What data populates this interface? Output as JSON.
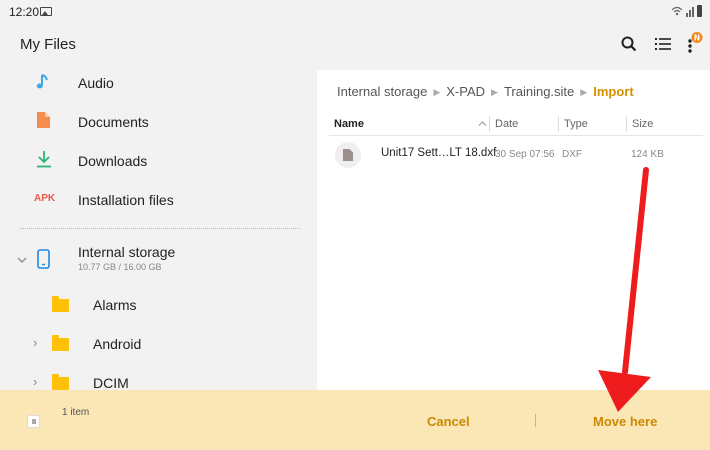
{
  "status": {
    "time": "12:20"
  },
  "appbar": {
    "title": "My Files",
    "notif_badge": "N"
  },
  "sidebar": {
    "items": [
      {
        "label": "Audio",
        "icon": "audio-note-icon"
      },
      {
        "label": "Documents",
        "icon": "document-icon"
      },
      {
        "label": "Downloads",
        "icon": "download-icon"
      },
      {
        "label": "Installation files",
        "icon_text": "APK"
      }
    ],
    "storage": {
      "label": "Internal storage",
      "usage": "10.77 GB / 16.00 GB"
    },
    "folders": [
      {
        "label": "Alarms"
      },
      {
        "label": "Android"
      },
      {
        "label": "DCIM"
      }
    ]
  },
  "main": {
    "breadcrumb": [
      "Internal storage",
      "X-PAD",
      "Training.site",
      "Import"
    ],
    "columns": {
      "name": "Name",
      "date": "Date",
      "type": "Type",
      "size": "Size"
    },
    "files": [
      {
        "name": "Unit17 Sett…LT 18.dxf",
        "date": "30 Sep 07:56",
        "type": "DXF",
        "size": "124 KB"
      }
    ]
  },
  "bottom": {
    "count": "1 item",
    "cancel": "Cancel",
    "move_here": "Move here"
  },
  "colors": {
    "accent": "#d69000",
    "bottom_bar": "#fbe6b6",
    "arrow": "#ee1c1c",
    "folder": "#ffc107"
  }
}
